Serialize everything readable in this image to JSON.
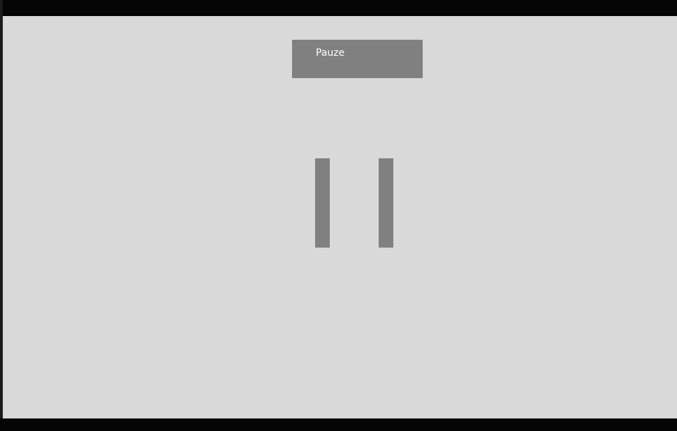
{
  "pause_screen": {
    "button_label": "Pauze",
    "icon": "pause-icon",
    "colors": {
      "background": "#d9d9d9",
      "button": "#808080",
      "button_text": "#ffffff",
      "icon": "#808080",
      "frame": "#050505"
    }
  }
}
